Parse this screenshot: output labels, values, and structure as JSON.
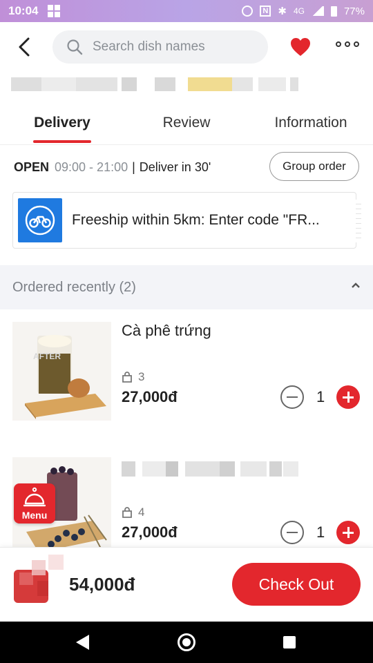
{
  "status_bar": {
    "time": "10:04",
    "network": "4G",
    "battery": "77%"
  },
  "header": {
    "search_placeholder": "Search dish names"
  },
  "tabs": [
    {
      "label": "Delivery",
      "active": true
    },
    {
      "label": "Review",
      "active": false
    },
    {
      "label": "Information",
      "active": false
    }
  ],
  "store": {
    "open_label": "OPEN",
    "hours": "09:00 - 21:00",
    "separator": "|",
    "deliver_text": "Deliver in 30'",
    "group_order_label": "Group order"
  },
  "promo": {
    "text": "Freeship within 5km: Enter code \"FR..."
  },
  "section": {
    "title": "Ordered recently (2)"
  },
  "items": [
    {
      "name": "Cà phê trứng",
      "sold_count": "3",
      "price": "27,000đ",
      "quantity": "1",
      "image_watermark": "AFTER"
    },
    {
      "name": "",
      "sold_count": "4",
      "price": "27,000đ",
      "quantity": "1"
    }
  ],
  "menu_fab": {
    "label": "Menu"
  },
  "cart": {
    "total": "54,000đ",
    "checkout_label": "Check Out"
  },
  "colors": {
    "accent": "#e3272d",
    "promo_blue": "#1f7ae0",
    "section_bg": "#f3f4f8"
  }
}
